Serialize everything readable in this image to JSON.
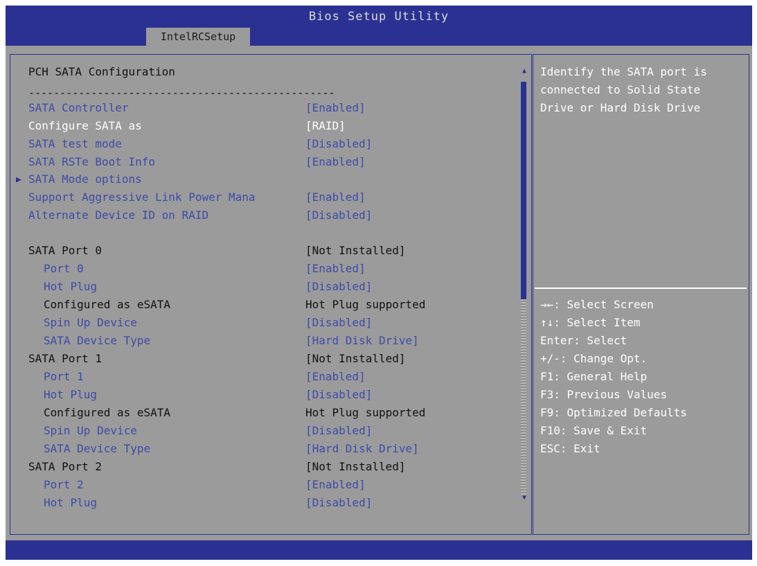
{
  "title": "Bios Setup Utility",
  "tab": "IntelRCSetup",
  "section_title": "PCH SATA Configuration",
  "divider_text": "-------------------------------------------------",
  "settings": [
    {
      "label": "SATA Controller",
      "value": "[Enabled]"
    },
    {
      "label": "Configure SATA as",
      "value": "[RAID]"
    },
    {
      "label": "SATA test mode",
      "value": "[Disabled]"
    },
    {
      "label": "SATA RSTe Boot Info",
      "value": "[Enabled]"
    },
    {
      "label": "SATA Mode options",
      "value": ""
    },
    {
      "label": "Support Aggressive Link Power Mana",
      "value": "[Enabled]"
    },
    {
      "label": "Alternate Device ID on RAID",
      "value": "[Disabled]"
    }
  ],
  "ports": [
    {
      "label": "SATA Port 0",
      "status": "[Not Installed]",
      "rows": [
        {
          "label": "Port 0",
          "value": "[Enabled]"
        },
        {
          "label": "Hot Plug",
          "value": "[Disabled]"
        },
        {
          "label": "Configured as eSATA",
          "value": "Hot Plug supported"
        },
        {
          "label": "Spin Up Device",
          "value": "[Disabled]"
        },
        {
          "label": "SATA Device Type",
          "value": "[Hard Disk Drive]"
        }
      ]
    },
    {
      "label": "SATA Port 1",
      "status": "[Not Installed]",
      "rows": [
        {
          "label": "Port 1",
          "value": "[Enabled]"
        },
        {
          "label": "Hot Plug",
          "value": "[Disabled]"
        },
        {
          "label": "Configured as eSATA",
          "value": "Hot Plug supported"
        },
        {
          "label": "Spin Up Device",
          "value": "[Disabled]"
        },
        {
          "label": "SATA Device Type",
          "value": "[Hard Disk Drive]"
        }
      ]
    },
    {
      "label": "SATA Port 2",
      "status": "[Not Installed]",
      "rows": [
        {
          "label": "Port 2",
          "value": "[Enabled]"
        },
        {
          "label": "Hot Plug",
          "value": "[Disabled]"
        }
      ]
    }
  ],
  "help": [
    "Identify the SATA port is",
    "connected to Solid State",
    "Drive or Hard Disk Drive"
  ],
  "keys": [
    "→←: Select Screen",
    "↑↓: Select Item",
    "Enter: Select",
    "+/-: Change Opt.",
    "F1: General Help",
    "F3: Previous Values",
    "F9: Optimized Defaults",
    "F10: Save & Exit",
    "ESC: Exit"
  ],
  "colors": {
    "header": "#2b3192",
    "background": "#9b9b9b",
    "selected_text": "#ffffff",
    "option_text": "#3e4aa8",
    "info_text": "#111111"
  },
  "icons": {
    "submenu": "submenu-arrow-icon",
    "scroll_up": "scroll-up-icon",
    "scroll_down": "scroll-down-icon"
  }
}
